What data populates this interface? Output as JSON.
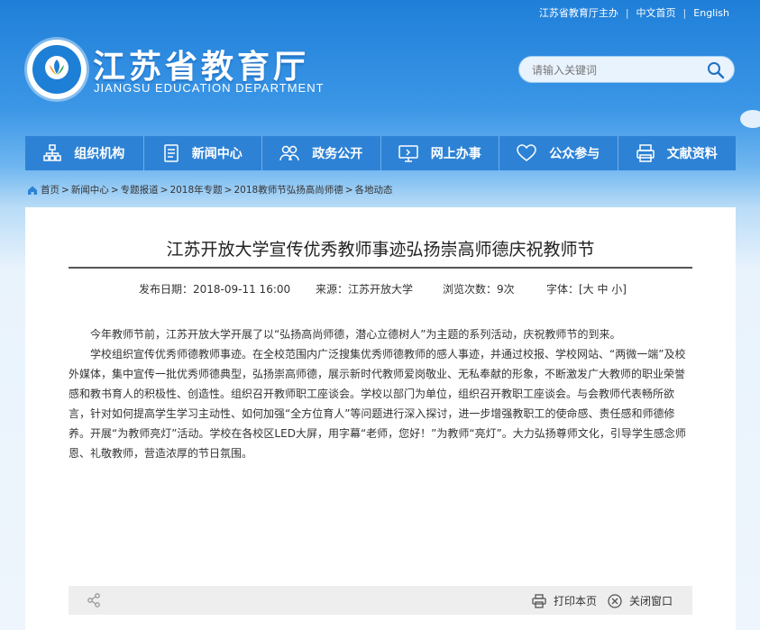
{
  "header": {
    "sponsor": "江苏省教育厅主办",
    "lang_cn": "中文首页",
    "lang_en": "English",
    "title_cn": "江苏省教育厅",
    "title_en": "JIANGSU EDUCATION DEPARTMENT",
    "search_placeholder": "请输入关键词"
  },
  "nav": [
    {
      "label": "组织机构",
      "icon": "org-chart-icon"
    },
    {
      "label": "新闻中心",
      "icon": "document-icon"
    },
    {
      "label": "政务公开",
      "icon": "people-icon"
    },
    {
      "label": "网上办事",
      "icon": "monitor-icon"
    },
    {
      "label": "公众参与",
      "icon": "heart-icon"
    },
    {
      "label": "文献资料",
      "icon": "printer-doc-icon"
    }
  ],
  "breadcrumb": [
    "首页",
    "新闻中心",
    "专题报道",
    "2018年专题",
    "2018教师节弘扬高尚师德",
    "各地动态"
  ],
  "article": {
    "title": "江苏开放大学宣传优秀教师事迹弘扬崇高师德庆祝教师节",
    "date": "发布日期：2018-09-11 16:00",
    "source": "来源：江苏开放大学",
    "views": "浏览次数：9次",
    "fontsize": "字体：[大 中 小]",
    "paragraphs": [
      "今年教师节前，江苏开放大学开展了以“弘扬高尚师德，潜心立德树人”为主题的系列活动，庆祝教师节的到来。",
      "学校组织宣传优秀师德教师事迹。在全校范围内广泛搜集优秀师德教师的感人事迹，并通过校报、学校网站、“两微一端”及校外媒体，集中宣传一批优秀师德典型，弘扬崇高师德，展示新时代教师爱岗敬业、无私奉献的形象，不断激发广大教师的职业荣誉感和教书育人的积极性、创造性。组织召开教师职工座谈会。学校以部门为单位，组织召开教职工座谈会。与会教师代表畅所欲言，针对如何提高学生学习主动性、如何加强“全方位育人”等问题进行深入探讨，进一步增强教职工的使命感、责任感和师德修养。开展“为教师亮灯”活动。学校在各校区LED大屏，用字幕“老师，您好！”为教师“亮灯”。大力弘扬尊师文化，引导学生感念师恩、礼敬教师，营造浓厚的节日氛围。"
    ]
  },
  "footer": {
    "print": "打印本页",
    "close": "关闭窗口"
  },
  "colors": {
    "nav": "#2d82d5",
    "header": "#1f7fd8"
  }
}
